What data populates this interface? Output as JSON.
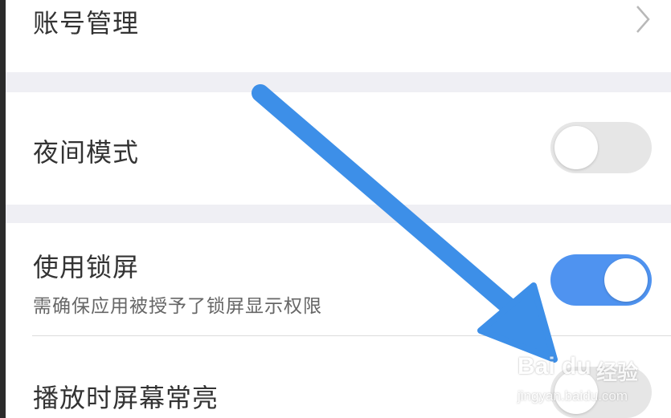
{
  "settings": {
    "account": {
      "label": "账号管理",
      "chevron_icon": "chevron-right-icon"
    },
    "night_mode": {
      "label": "夜间模式",
      "enabled": false
    },
    "lock_screen": {
      "label": "使用锁屏",
      "description": "需确保应用被授予了锁屏显示权限",
      "enabled": true
    },
    "keep_screen_on": {
      "label": "播放时屏幕常亮",
      "enabled": false
    }
  },
  "annotation": {
    "arrow_color": "#3d8fe8",
    "points_to": "keep-screen-on-toggle"
  },
  "watermark": {
    "logo": "Bai du",
    "brand_cn": "经验",
    "url": "jingyan.baidu.com"
  },
  "colors": {
    "toggle_on": "#4f93f0",
    "toggle_off": "#e6e6e6",
    "section_gap": "#efeff4"
  }
}
